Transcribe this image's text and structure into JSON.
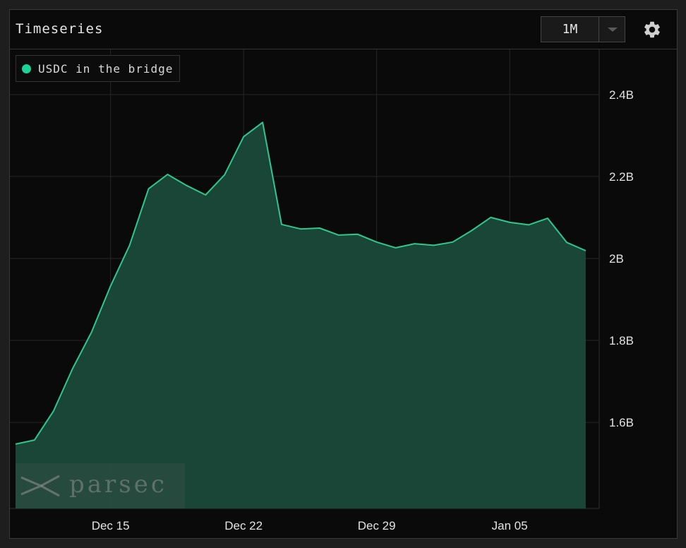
{
  "header": {
    "title": "Timeseries",
    "range_value": "1M"
  },
  "legend": {
    "label": "USDC in the bridge"
  },
  "watermark": {
    "text": "parsec"
  },
  "colors": {
    "series_line": "#2ec790",
    "series_fill": "#1a4a3a",
    "legend_dot": "#19d496"
  },
  "chart_data": {
    "type": "area",
    "title": "Timeseries",
    "xlabel": "",
    "ylabel": "",
    "ylim": [
      1.39,
      2.51
    ],
    "x_ticks": [
      {
        "label": "Dec 15",
        "date": "2022-12-15"
      },
      {
        "label": "Dec 22",
        "date": "2022-12-22"
      },
      {
        "label": "Dec 29",
        "date": "2022-12-29"
      },
      {
        "label": "Jan 05",
        "date": "2023-01-05"
      }
    ],
    "y_ticks": [
      {
        "label": "1.6B",
        "value": 1.6
      },
      {
        "label": "1.8B",
        "value": 1.8
      },
      {
        "label": "2B",
        "value": 2.0
      },
      {
        "label": "2.2B",
        "value": 2.2
      },
      {
        "label": "2.4B",
        "value": 2.4
      }
    ],
    "grid": true,
    "y_axis_position": "right",
    "legend_position": "top-left",
    "series": [
      {
        "name": "USDC in the bridge",
        "x": [
          "2022-12-10",
          "2022-12-11",
          "2022-12-12",
          "2022-12-13",
          "2022-12-14",
          "2022-12-15",
          "2022-12-16",
          "2022-12-17",
          "2022-12-18",
          "2022-12-19",
          "2022-12-20",
          "2022-12-21",
          "2022-12-22",
          "2022-12-23",
          "2022-12-24",
          "2022-12-25",
          "2022-12-26",
          "2022-12-27",
          "2022-12-28",
          "2022-12-29",
          "2022-12-30",
          "2022-12-31",
          "2023-01-01",
          "2023-01-02",
          "2023-01-03",
          "2023-01-04",
          "2023-01-05",
          "2023-01-06",
          "2023-01-07",
          "2023-01-08",
          "2023-01-09"
        ],
        "values": [
          1.547,
          1.557,
          1.628,
          1.731,
          1.82,
          1.933,
          2.032,
          2.17,
          2.205,
          2.178,
          2.155,
          2.204,
          2.297,
          2.332,
          2.083,
          2.072,
          2.074,
          2.057,
          2.059,
          2.04,
          2.026,
          2.036,
          2.032,
          2.04,
          2.068,
          2.1,
          2.088,
          2.082,
          2.098,
          2.039,
          2.019
        ]
      }
    ]
  }
}
